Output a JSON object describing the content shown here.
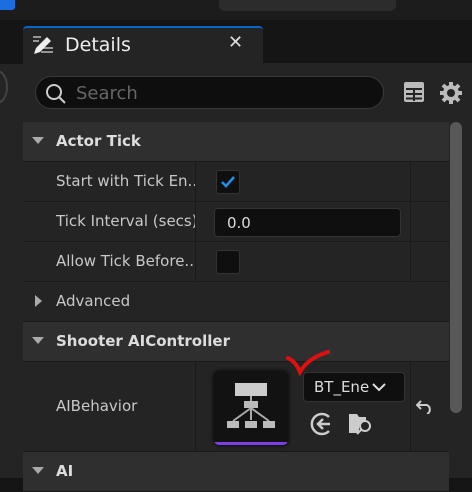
{
  "panel": {
    "title": "Details",
    "tab_icon": "pencil-list-icon",
    "close_icon": "close-icon"
  },
  "search": {
    "placeholder": "Search",
    "value": ""
  },
  "sections": [
    {
      "label": "Actor Tick",
      "expanded": true
    },
    {
      "label": "Advanced",
      "expanded": false
    },
    {
      "label": "Shooter AIController",
      "expanded": true
    },
    {
      "label": "AI",
      "expanded": true
    }
  ],
  "actor_tick": {
    "start_with_tick": {
      "label": "Start with Tick En...",
      "checked": true
    },
    "tick_interval": {
      "label": "Tick Interval (secs)",
      "value": "0.0"
    },
    "allow_tick_before": {
      "label": "Allow Tick Before...",
      "checked": false
    }
  },
  "ai_behavior": {
    "label": "AIBehavior",
    "asset": "BT_Ene",
    "accent": "#7b3fe4"
  },
  "colors": {
    "accent": "#1f8ff0",
    "annotation": "#e01010"
  }
}
